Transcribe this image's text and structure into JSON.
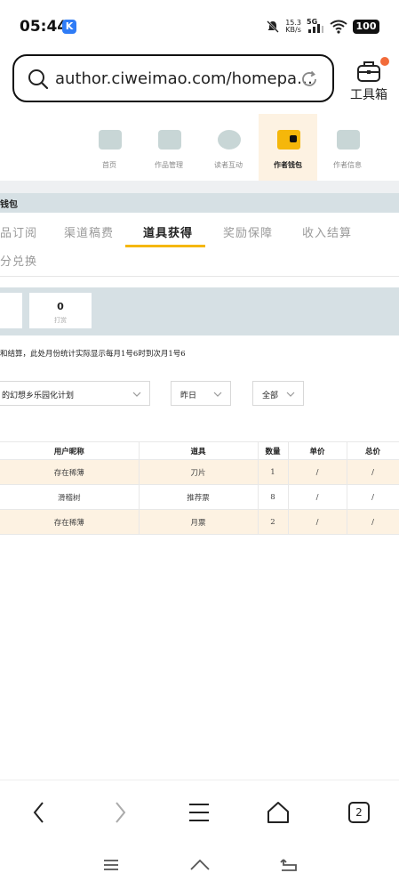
{
  "status_bar": {
    "time": "05:44",
    "app_badge": "K",
    "net_speed": "15.3",
    "net_unit": "KB/s",
    "network": "5G",
    "battery": "100"
  },
  "browser": {
    "url": "author.ciweimao.com/homepa…",
    "toolbox_label": "工具箱"
  },
  "site_nav": {
    "items": [
      {
        "label": "首页",
        "icon": "house-icon"
      },
      {
        "label": "作品管理",
        "icon": "book-icon"
      },
      {
        "label": "读者互动",
        "icon": "chat-icon"
      },
      {
        "label": "作者钱包",
        "icon": "wallet-icon"
      },
      {
        "label": "作者信息",
        "icon": "id-card-icon"
      }
    ],
    "active_index": 3
  },
  "section": {
    "title": "钱包"
  },
  "tabs": {
    "items": [
      "品订阅",
      "渠道稿费",
      "道具获得",
      "奖励保障",
      "收入结算",
      "分兑换"
    ],
    "active_index": 2
  },
  "stats": {
    "boxes": [
      {
        "value": "0",
        "label": "打赏"
      }
    ]
  },
  "note": "和结算，此处月份统计实际显示每月1号6时到次月1号6",
  "filters": {
    "book": "的幻想乡乐园化计划",
    "date": "昨日",
    "type": "全部"
  },
  "table": {
    "headers": [
      "用户昵称",
      "道具",
      "数量",
      "单价",
      "总价"
    ],
    "rows": [
      [
        "存在稀薄",
        "刀片",
        "1",
        "/",
        "/"
      ],
      [
        "滑稽树",
        "推荐票",
        "8",
        "/",
        "/"
      ],
      [
        "存在稀薄",
        "月票",
        "2",
        "/",
        "/"
      ]
    ]
  },
  "bottom_nav": {
    "tab_count": "2"
  },
  "colors": {
    "accent": "#f5b70a",
    "highlight_row": "#fdf2e2",
    "band": "#d6e0e4",
    "notification_dot": "#f26b3a"
  }
}
